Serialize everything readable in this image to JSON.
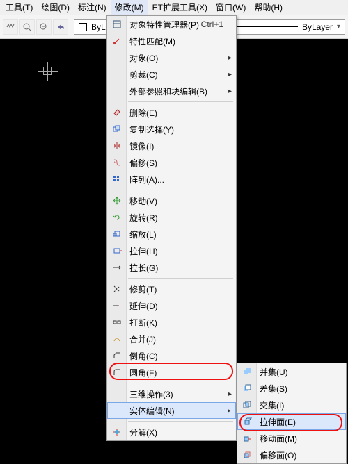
{
  "menubar": {
    "items": [
      {
        "label": "工具(T)"
      },
      {
        "label": "绘图(D)"
      },
      {
        "label": "标注(N)"
      },
      {
        "label": "修改(M)"
      },
      {
        "label": "ET扩展工具(X)"
      },
      {
        "label": "窗口(W)"
      },
      {
        "label": "帮助(H)"
      }
    ]
  },
  "toolbar": {
    "bylayer": "ByLayer",
    "bylayer2": "ByLayer"
  },
  "menu": {
    "items": [
      {
        "label": "对象特性管理器(P)",
        "shortcut": "Ctrl+1",
        "icon": "props"
      },
      {
        "label": "特性匹配(M)",
        "icon": "match"
      },
      {
        "label": "对象(O)",
        "sub": true
      },
      {
        "label": "剪裁(C)",
        "sub": true
      },
      {
        "label": "外部参照和块编辑(B)",
        "sub": true
      },
      {
        "sep": true
      },
      {
        "label": "删除(E)",
        "icon": "erase"
      },
      {
        "label": "复制选择(Y)",
        "icon": "copy"
      },
      {
        "label": "镜像(I)",
        "icon": "mirror"
      },
      {
        "label": "偏移(S)",
        "icon": "offset"
      },
      {
        "label": "阵列(A)...",
        "icon": "array"
      },
      {
        "sep": true
      },
      {
        "label": "移动(V)",
        "icon": "move"
      },
      {
        "label": "旋转(R)",
        "icon": "rotate"
      },
      {
        "label": "缩放(L)",
        "icon": "scale"
      },
      {
        "label": "拉伸(H)",
        "icon": "stretch"
      },
      {
        "label": "拉长(G)",
        "icon": "lengthen"
      },
      {
        "sep": true
      },
      {
        "label": "修剪(T)",
        "icon": "trim"
      },
      {
        "label": "延伸(D)",
        "icon": "extend"
      },
      {
        "label": "打断(K)",
        "icon": "break"
      },
      {
        "label": "合并(J)",
        "icon": "join"
      },
      {
        "label": "倒角(C)",
        "icon": "chamfer"
      },
      {
        "label": "圆角(F)",
        "icon": "fillet"
      },
      {
        "sep": true
      },
      {
        "label": "三维操作(3)",
        "sub": true
      },
      {
        "label": "实体编辑(N)",
        "sub": true,
        "hover": true
      },
      {
        "sep": true
      },
      {
        "label": "分解(X)",
        "icon": "explode"
      }
    ]
  },
  "submenu": {
    "items": [
      {
        "label": "并集(U)",
        "icon": "union"
      },
      {
        "label": "差集(S)",
        "icon": "subtract"
      },
      {
        "label": "交集(I)",
        "icon": "intersect"
      },
      {
        "label": "拉伸面(E)",
        "icon": "extrf",
        "hover": true
      },
      {
        "label": "移动面(M)",
        "icon": "movef"
      },
      {
        "label": "偏移面(O)",
        "icon": "offsf"
      }
    ]
  }
}
